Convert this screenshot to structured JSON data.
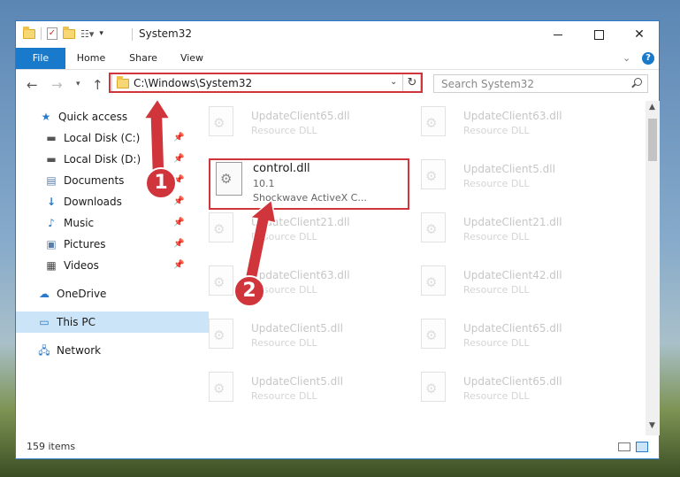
{
  "window": {
    "title": "System32"
  },
  "ribbon": {
    "tabs": [
      {
        "label": "File"
      },
      {
        "label": "Home"
      },
      {
        "label": "Share"
      },
      {
        "label": "View"
      }
    ]
  },
  "address": {
    "path": "C:\\Windows\\System32"
  },
  "search": {
    "placeholder": "Search System32"
  },
  "sidebar": {
    "items": [
      {
        "label": "Quick access",
        "icon": "star-icon",
        "pinned": false
      },
      {
        "label": "Local Disk (C:)",
        "icon": "drive-icon",
        "pinned": true
      },
      {
        "label": "Local Disk (D:)",
        "icon": "drive-icon",
        "pinned": true
      },
      {
        "label": "Documents",
        "icon": "documents-icon",
        "pinned": true
      },
      {
        "label": "Downloads",
        "icon": "download-icon",
        "pinned": true
      },
      {
        "label": "Music",
        "icon": "music-icon",
        "pinned": true
      },
      {
        "label": "Pictures",
        "icon": "pictures-icon",
        "pinned": true
      },
      {
        "label": "Videos",
        "icon": "videos-icon",
        "pinned": true
      },
      {
        "label": "OneDrive",
        "icon": "cloud-icon",
        "pinned": false
      },
      {
        "label": "This PC",
        "icon": "computer-icon",
        "pinned": false,
        "selected": true
      },
      {
        "label": "Network",
        "icon": "network-icon",
        "pinned": false
      }
    ]
  },
  "files": {
    "highlighted": {
      "name": "control.dll",
      "version": "10.1",
      "description": "Shockwave ActiveX C..."
    },
    "background": [
      {
        "name": "UpdateClient65.dll",
        "description": "Resource DLL"
      },
      {
        "name": "UpdateClient63.dll",
        "description": "Resource DLL"
      },
      {
        "name": "UpdateClient5.dll",
        "description": "Resource DLL"
      },
      {
        "name": "UpdateClient21.dll",
        "description": "Resource DLL"
      },
      {
        "name": "UpdateClient21.dll",
        "description": "Resource DLL"
      },
      {
        "name": "UpdateClient63.dll",
        "description": "Resource DLL"
      },
      {
        "name": "UpdateClient42.dll",
        "description": "Resource DLL"
      },
      {
        "name": "UpdateClient5.dll",
        "description": "Resource DLL"
      },
      {
        "name": "UpdateClient65.dll",
        "description": "Resource DLL"
      },
      {
        "name": "UpdateClient5.dll",
        "description": "Resource DLL"
      },
      {
        "name": "UpdateClient65.dll",
        "description": "Resource DLL"
      }
    ]
  },
  "status": {
    "count": "159 items"
  },
  "annotations": {
    "step1": "1",
    "step2": "2",
    "color": "#d0353c"
  },
  "colors": {
    "accent": "#1979ca",
    "selection": "#cce4f7"
  }
}
